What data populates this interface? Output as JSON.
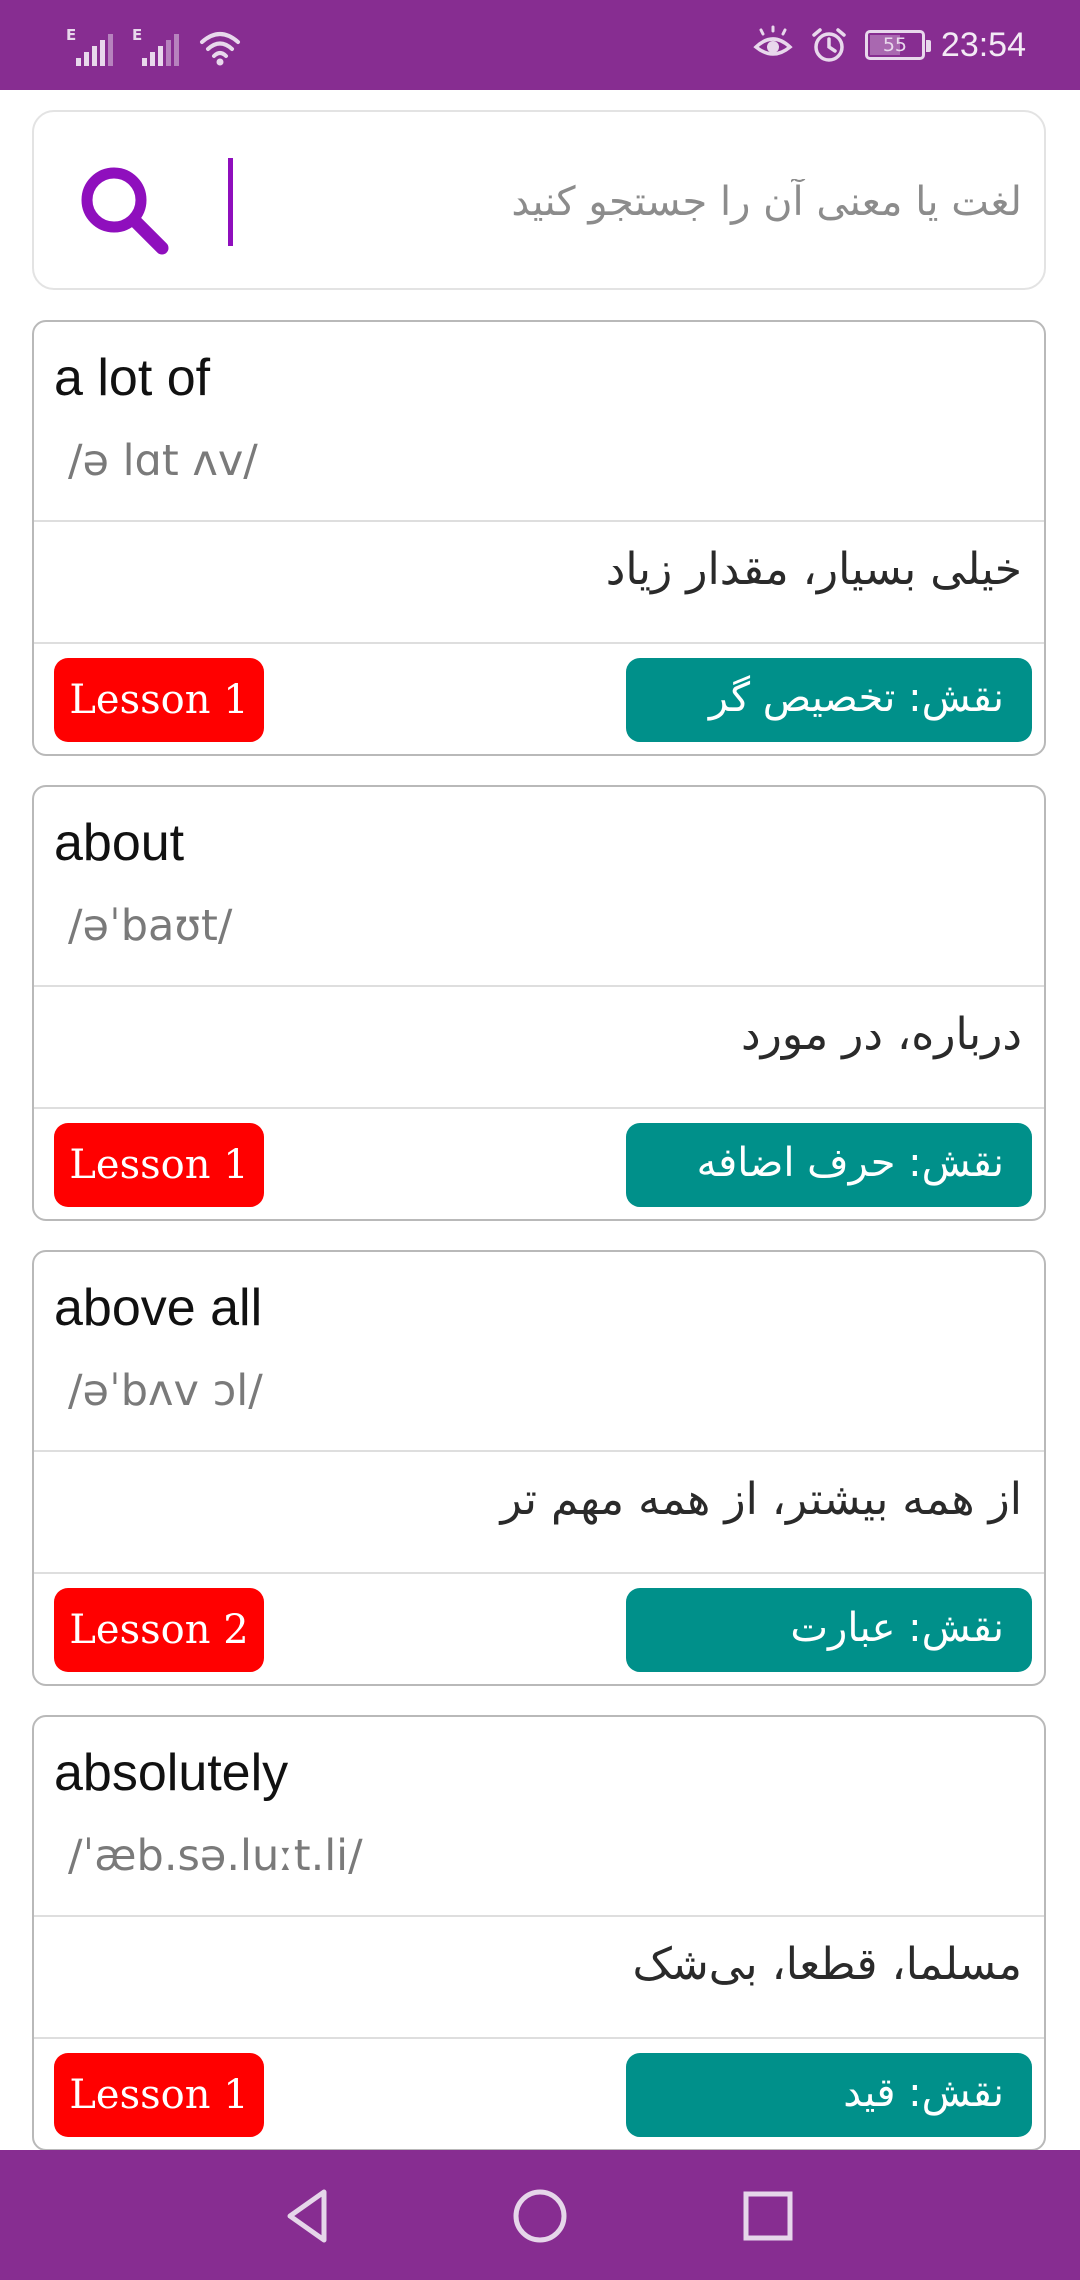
{
  "status_bar": {
    "time": "23:54",
    "battery_level": "55",
    "signal_label_1": "E",
    "signal_label_2": "E",
    "icons": [
      "signal-icon",
      "signal-icon",
      "wifi-icon",
      "eye-comfort-icon",
      "alarm-icon",
      "battery-icon"
    ]
  },
  "search": {
    "placeholder": "لغت یا معنی آن را جستجو کنید",
    "value": "",
    "icon": "search-icon",
    "accent_color": "#8f0fbd"
  },
  "colors": {
    "status_bar": "#872d91",
    "lesson_badge": "#ff0000",
    "role_badge": "#00908a"
  },
  "words": [
    {
      "word": "a lot of",
      "phonetic": "/ə lɑt ʌv/",
      "meaning": "خیلی بسیار، مقدار زیاد",
      "lesson": "Lesson 1",
      "role": "نقش: تخصیص گر"
    },
    {
      "word": "about",
      "phonetic": "/əˈbaʊt/",
      "meaning": "درباره، در مورد",
      "lesson": "Lesson 1",
      "role": "نقش: حرف اضافه"
    },
    {
      "word": "above all",
      "phonetic": "/əˈbʌv ɔl/",
      "meaning": "از همه بیشتر، از همه مهم تر",
      "lesson": "Lesson 2",
      "role": "نقش: عبارت"
    },
    {
      "word": "absolutely",
      "phonetic": "/ˈæb.sə.luːt.li/",
      "meaning": "مسلما، قطعا، بی‌شک",
      "lesson": "Lesson 1",
      "role": "نقش: قید"
    }
  ],
  "nav": {
    "back_icon": "back-icon",
    "home_icon": "home-icon",
    "recents_icon": "recents-icon"
  }
}
